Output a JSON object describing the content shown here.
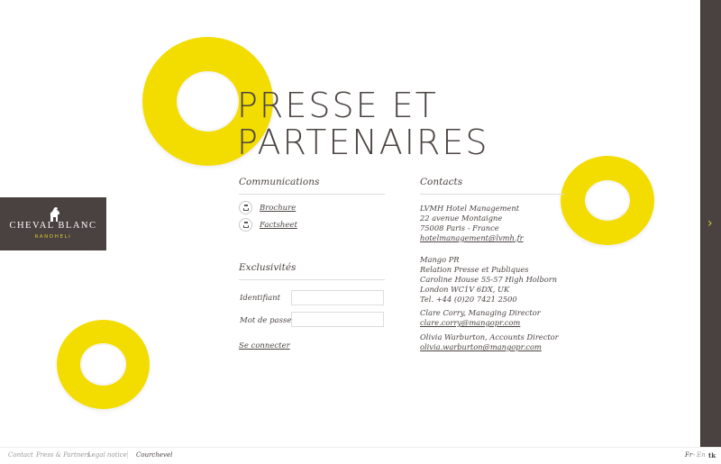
{
  "page": {
    "title_line1": "PRESSE ET",
    "title_line2": "PARTENAIRES"
  },
  "logo": {
    "brand": "CHEVAL BLANC",
    "location": "RANDHELI"
  },
  "communications": {
    "heading": "Communications",
    "links": [
      "Brochure",
      "Factsheet"
    ]
  },
  "exclusivites": {
    "heading": "Exclusivités",
    "identifiant_label": "Identifiant",
    "password_label": "Mot de passe",
    "identifiant_value": "",
    "password_value": "",
    "connect_label": "Se connecter"
  },
  "contacts": {
    "heading": "Contacts",
    "lvmh": {
      "name": "LVMH Hotel Management",
      "street": "22 avenue Montaigne",
      "city": "75008 Paris - France",
      "email": "hotelmanagement@lvmh.fr"
    },
    "mango": {
      "name": "Mango PR",
      "role": "Relation Presse et Publiques",
      "street": "Caroline House 55-57 High Holborn",
      "city": "London WC1V 6DX, UK",
      "tel": "Tel. +44 (0)20 7421 2500",
      "contact1": "Clare Corry, Managing Director",
      "email1": "clare.corry@mangopr.com",
      "contact2": "Olivia Warburton, Accounts Director",
      "email2": "olivia.warburton@mangopr.com"
    }
  },
  "footer": {
    "links": [
      "Contact",
      "Press & Partners",
      "Legal notice"
    ],
    "site": "Courchevel",
    "lang_fr": "Fr",
    "lang_sep": "-",
    "lang_en": "En",
    "social": "tk"
  },
  "colors": {
    "accent_yellow": "#f3dc00",
    "dark_brown": "#4a4240",
    "gold_text": "#d8c833"
  },
  "icons": {
    "next": "chevron-right-icon",
    "doc": "document-icon"
  }
}
